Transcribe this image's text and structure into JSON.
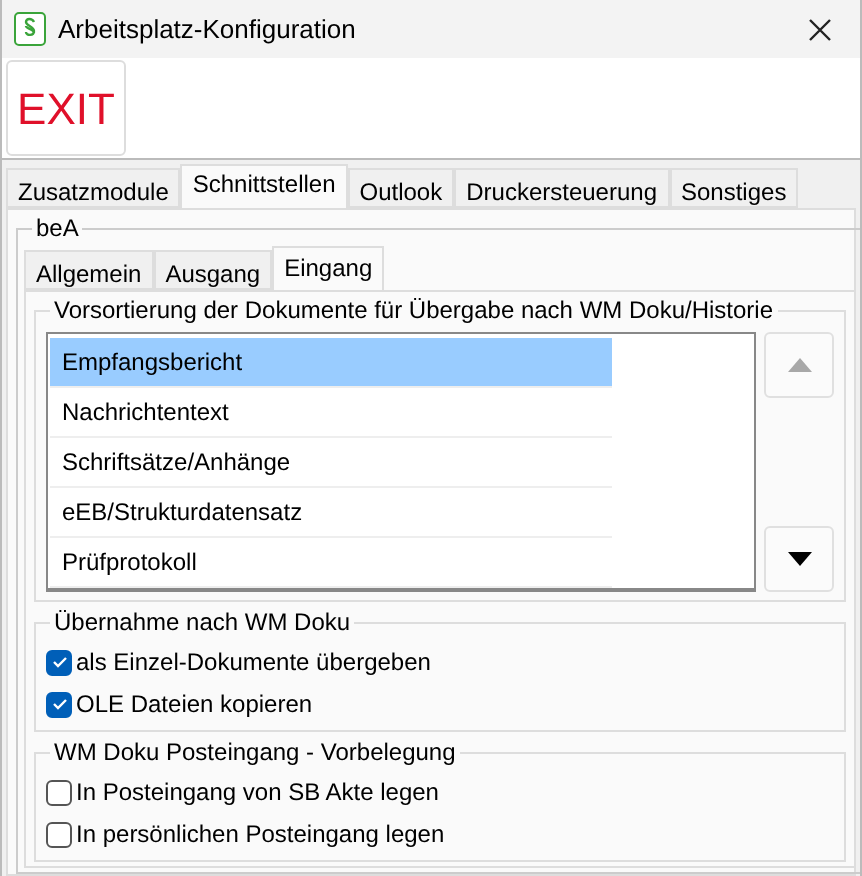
{
  "window": {
    "title": "Arbeitsplatz-Konfiguration"
  },
  "toolbar": {
    "exit_label": "EXIT"
  },
  "tabs": [
    {
      "label": "Zusatzmodule",
      "selected": false
    },
    {
      "label": "Schnittstellen",
      "selected": true
    },
    {
      "label": "Outlook",
      "selected": false
    },
    {
      "label": "Druckersteuerung",
      "selected": false
    },
    {
      "label": "Sonstiges",
      "selected": false
    }
  ],
  "section": {
    "title": "beA",
    "tabs": [
      {
        "label": "Allgemein",
        "selected": false
      },
      {
        "label": "Ausgang",
        "selected": false
      },
      {
        "label": "Eingang",
        "selected": true
      }
    ],
    "sort_group": {
      "title": "Vorsortierung der Dokumente für Übergabe nach WM Doku/Historie",
      "items": [
        {
          "label": "Empfangsbericht",
          "selected": true
        },
        {
          "label": "Nachrichtentext",
          "selected": false
        },
        {
          "label": "Schriftsätze/Anhänge",
          "selected": false
        },
        {
          "label": "eEB/Strukturdatensatz",
          "selected": false
        },
        {
          "label": "Prüfprotokoll",
          "selected": false
        }
      ],
      "move_up": {
        "disabled": true
      },
      "move_down": {
        "disabled": false
      }
    },
    "groups": [
      {
        "title": "Übernahme nach WM Doku",
        "options": [
          {
            "label": "als Einzel-Dokumente übergeben",
            "checked": true
          },
          {
            "label": "OLE Dateien kopieren",
            "checked": true
          }
        ]
      },
      {
        "title": "WM Doku Posteingang - Vorbelegung",
        "options": [
          {
            "label": "In Posteingang von SB Akte legen",
            "checked": false
          },
          {
            "label": "In persönlichen Posteingang legen",
            "checked": false
          }
        ]
      }
    ]
  }
}
